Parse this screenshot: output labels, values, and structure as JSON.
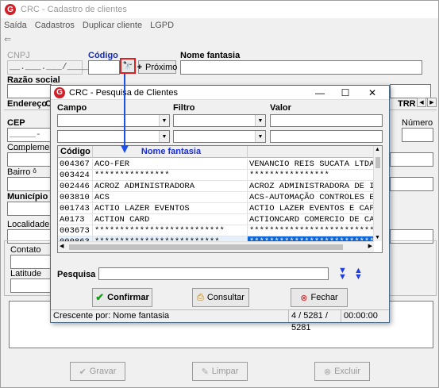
{
  "window": {
    "title": "CRC - Cadastro de clientes"
  },
  "menu": [
    "Saída",
    "Cadastros",
    "Duplicar cliente",
    "LGPD"
  ],
  "form": {
    "cnpj_label": "CNPJ",
    "cnpj_mask": "__.___.___/____-__",
    "codigo_label": "Código",
    "proximo_label": "Próximo",
    "nome_fantasia_label": "Nome fantasia",
    "razao_social_label": "Razão social",
    "tabs": [
      "Endereço",
      "C"
    ],
    "tab_trr": "TRR",
    "cep_label": "CEP",
    "cep_mask": "_____-___",
    "numero_label": "Número",
    "complemento_label": "Complemento",
    "bairro_label": "Bairro",
    "bairro_mark": "ô",
    "municipio_label": "Município",
    "localidade_label": "Localidade",
    "contato_label": "Contato",
    "latitude_label": "Latitude",
    "gravar_label": "Gravar",
    "limpar_label": "Limpar",
    "excluir_label": "Excluir"
  },
  "dialog": {
    "title": "CRC - Pesquisa de Clientes",
    "campo_label": "Campo",
    "filtro_label": "Filtro",
    "valor_label": "Valor",
    "columns": [
      "Código",
      "Nome fantasia",
      ""
    ],
    "rows": [
      [
        "004367",
        "ACO-FER",
        "VENANCIO REIS SUCATA LTDA"
      ],
      [
        "003424",
        "***************",
        "****************"
      ],
      [
        "002446",
        "ACROZ ADMINISTRADORA",
        "ACROZ ADMINISTRADORA DE IMO"
      ],
      [
        "003810",
        "ACS",
        "ACS-AUTOMAÇÃO CONTROLES E S"
      ],
      [
        "001743",
        "ACTIO LAZER EVENTOS",
        "ACTIO LAZER EVENTOS E CAFE"
      ],
      [
        "A0173",
        "ACTION CARD",
        "ACTIONCARD COMERCIO DE CART"
      ],
      [
        "003673",
        "**************************",
        "*************************"
      ],
      [
        "000863",
        "*************************",
        "***************************"
      ]
    ],
    "pesquisa_label": "Pesquisa",
    "confirmar_label": "Confirmar",
    "consultar_label": "Consultar",
    "fechar_label": "Fechar",
    "status_order": "Crescente por: Nome fantasia",
    "status_count": "4 / 5281 / 5281",
    "status_time": "00:00:00"
  },
  "colors": {
    "accent": "#0a64d6",
    "logo": "#d0202a",
    "arrow": "#1e50e6",
    "highlight": "#e02020"
  }
}
